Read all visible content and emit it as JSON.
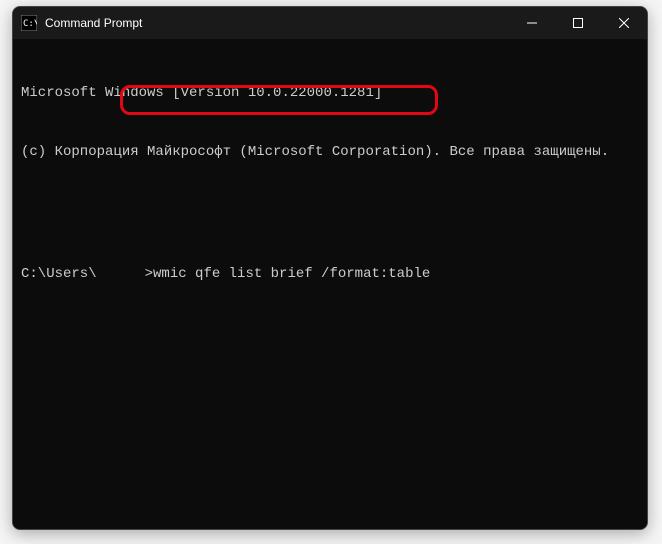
{
  "window": {
    "title": "Command Prompt"
  },
  "terminal": {
    "line1": "Microsoft Windows [Version 10.0.22000.1281]",
    "line2": "(c) Корпорация Майкрософт (Microsoft Corporation). Все права защищены.",
    "prompt_prefix": "C:\\Users\\",
    "prompt_suffix": ">",
    "command": "wmic qfe list brief /format:table"
  },
  "colors": {
    "highlight": "#e30613",
    "terminal_bg": "#0c0c0c",
    "terminal_fg": "#cccccc"
  }
}
